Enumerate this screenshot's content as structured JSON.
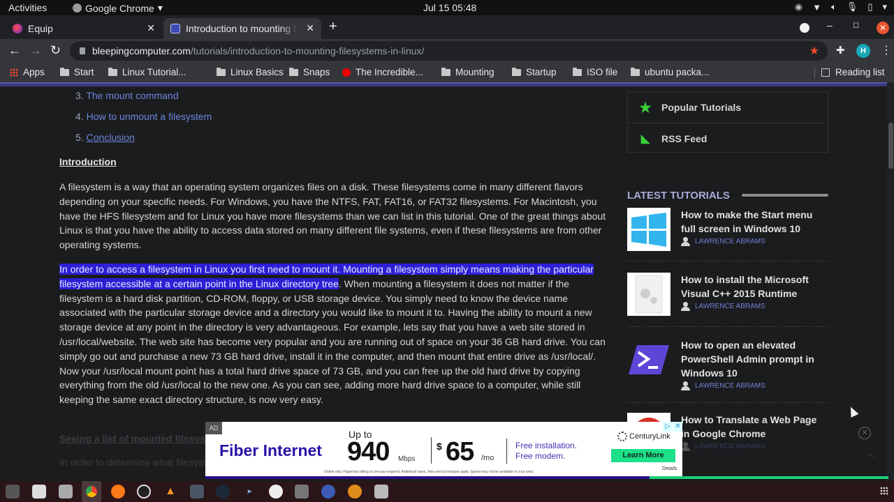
{
  "system": {
    "activities": "Activities",
    "app_name": "Google Chrome",
    "clock": "Jul 15  05:48"
  },
  "tabs": [
    {
      "title": "Equip",
      "active": false
    },
    {
      "title": "Introduction to mounting filesystems in Linux",
      "active": true
    }
  ],
  "address": {
    "host": "bleepingcomputer.com",
    "path": "/tutorials/introduction-to-mounting-filesystems-in-linux/"
  },
  "profile_initial": "H",
  "bookmarks": [
    {
      "label": "Apps",
      "icon": "apps-grid-icon"
    },
    {
      "label": "Start",
      "icon": "folder-icon"
    },
    {
      "label": "Linux Tutorial...",
      "icon": "folder-icon"
    },
    {
      "label": "Linux Basics",
      "icon": "folder-icon"
    },
    {
      "label": "Snaps",
      "icon": "folder-icon"
    },
    {
      "label": "The Incredible...",
      "icon": "youtube-icon"
    },
    {
      "label": "Mounting",
      "icon": "folder-icon"
    },
    {
      "label": "Startup",
      "icon": "folder-icon"
    },
    {
      "label": "ISO file",
      "icon": "folder-icon"
    },
    {
      "label": "ubuntu packa...",
      "icon": "folder-icon"
    }
  ],
  "reading_list": "Reading list",
  "article": {
    "toc": [
      {
        "num": "3.",
        "label": "The mount command"
      },
      {
        "num": "4.",
        "label": "How to unmount a filesystem"
      },
      {
        "num": "5.",
        "label": "Conclusion"
      }
    ],
    "intro_heading": "Introduction",
    "para1": "A filesystem is a way that an operating system organizes files on a disk. These filesystems come in many different flavors depending on your specific needs. For Windows, you have the NTFS, FAT, FAT16, or FAT32 filesystems. For Macintosh, you have the HFS filesystem and for Linux you have more filesystems than we can list in this tutorial. One of the great things about Linux is that you have the ability to access data stored on many different file systems, even if these filesystems are from other operating systems.",
    "para2_selected": "In order to access a filesystem in Linux you first need to mount it. Mounting a filesystem simply means making the particular filesystem accessible at a certain point in the Linux directory tree",
    "para2_rest": ". When mounting a filesystem it does not matter if the filesystem is a hard disk partition, CD-ROM, floppy, or USB storage device. You simply need to know the device name associated with the particular storage device and a directory you would like to mount it to. Having the ability to mount a new storage device at any point in the directory is very advantageous. For example, lets say that you have a web site stored in /usr/local/website. The web site has become very popular and you are running out of space on your 36 GB hard drive. You can simply go out and purchase a new 73 GB hard drive, install it in the computer, and then mount that entire drive as /usr/local/. Now your /usr/local mount point has a total hard drive space of 73 GB, and you can free up the old hard drive by copying everything from the old /usr/local to the new one. As you can see, adding more hard drive space to a computer, while still keeping the same exact directory structure, is now very easy.",
    "next_heading": "Seeing a list of mounted filesystems",
    "next_para": "In order to determine what filesystems"
  },
  "sidebar": {
    "links": [
      {
        "label": "Popular Tutorials",
        "icon": "star-icon"
      },
      {
        "label": "RSS Feed",
        "icon": "rss-icon"
      }
    ],
    "latest_title": "LATEST TUTORIALS",
    "tutorials": [
      {
        "title": "How to make the Start menu full screen in Windows 10",
        "author": "LAWRENCE ABRAMS",
        "thumb": "windows-logo"
      },
      {
        "title": "How to install the Microsoft Visual C++ 2015 Runtime",
        "author": "LAWRENCE ABRAMS",
        "thumb": "gears-file"
      },
      {
        "title": "How to open an elevated PowerShell Admin prompt in Windows 10",
        "author": "LAWRENCE ABRAMS",
        "thumb": "powershell"
      },
      {
        "title": "How to Translate a Web Page in Google Chrome",
        "author": "LAWRENCE ABRAMS",
        "thumb": "chrome"
      }
    ]
  },
  "ad": {
    "label": "AD",
    "headline": "Fiber Internet",
    "up_to": "Up to",
    "speed": "940",
    "speed_unit": "Mbps",
    "currency": "$",
    "price": "65",
    "price_unit": "/mo",
    "perk1": "Free installation.",
    "perk2": "Free modem.",
    "brand": "CenturyLink",
    "cta": "Learn More",
    "details": "Details",
    "fine_print": "Online only. Paperless billing or pre-pay required. Additional taxes, fees and surcharges apply. Speed may not be available in your area."
  },
  "dock": [
    "terminal",
    "files",
    "disk-utility",
    "chrome",
    "firefox",
    "obs",
    "vlc",
    "editor",
    "steam",
    "app",
    "vpn",
    "media",
    "keepass",
    "game",
    "usb-drive"
  ]
}
